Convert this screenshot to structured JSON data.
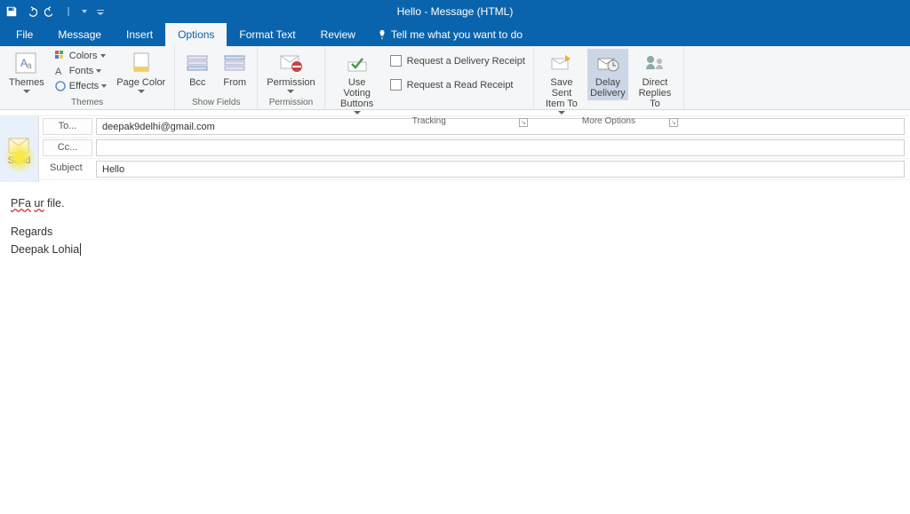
{
  "titlebar": {
    "title": "Hello  -  Message (HTML)"
  },
  "tabs": {
    "file": "File",
    "message": "Message",
    "insert": "Insert",
    "options": "Options",
    "formatText": "Format Text",
    "review": "Review",
    "tell": "Tell me what you want to do"
  },
  "ribbon": {
    "themes": {
      "themes": "Themes",
      "colors": "Colors",
      "fonts": "Fonts",
      "effects": "Effects",
      "pageColor": "Page Color",
      "label": "Themes"
    },
    "showFields": {
      "bcc": "Bcc",
      "from": "From",
      "label": "Show Fields"
    },
    "permission": {
      "permission": "Permission",
      "label": "Permission"
    },
    "tracking": {
      "voting": "Use Voting Buttons",
      "delivery": "Request a Delivery Receipt",
      "read": "Request a Read Receipt",
      "label": "Tracking"
    },
    "moreOptions": {
      "saveSent": "Save Sent Item To",
      "delay": "Delay Delivery",
      "direct": "Direct Replies To",
      "label": "More Options"
    }
  },
  "compose": {
    "send": "Send",
    "to": "To...",
    "toVal": "deepak9delhi@gmail.com",
    "cc": "Cc...",
    "ccVal": "",
    "subject": "Subject",
    "subjectVal": "Hello"
  },
  "body": {
    "l1a": "PFa",
    "l1b": "ur",
    "l1c": " file.",
    "l2": "Regards",
    "l3": "Deepak Lohia"
  }
}
